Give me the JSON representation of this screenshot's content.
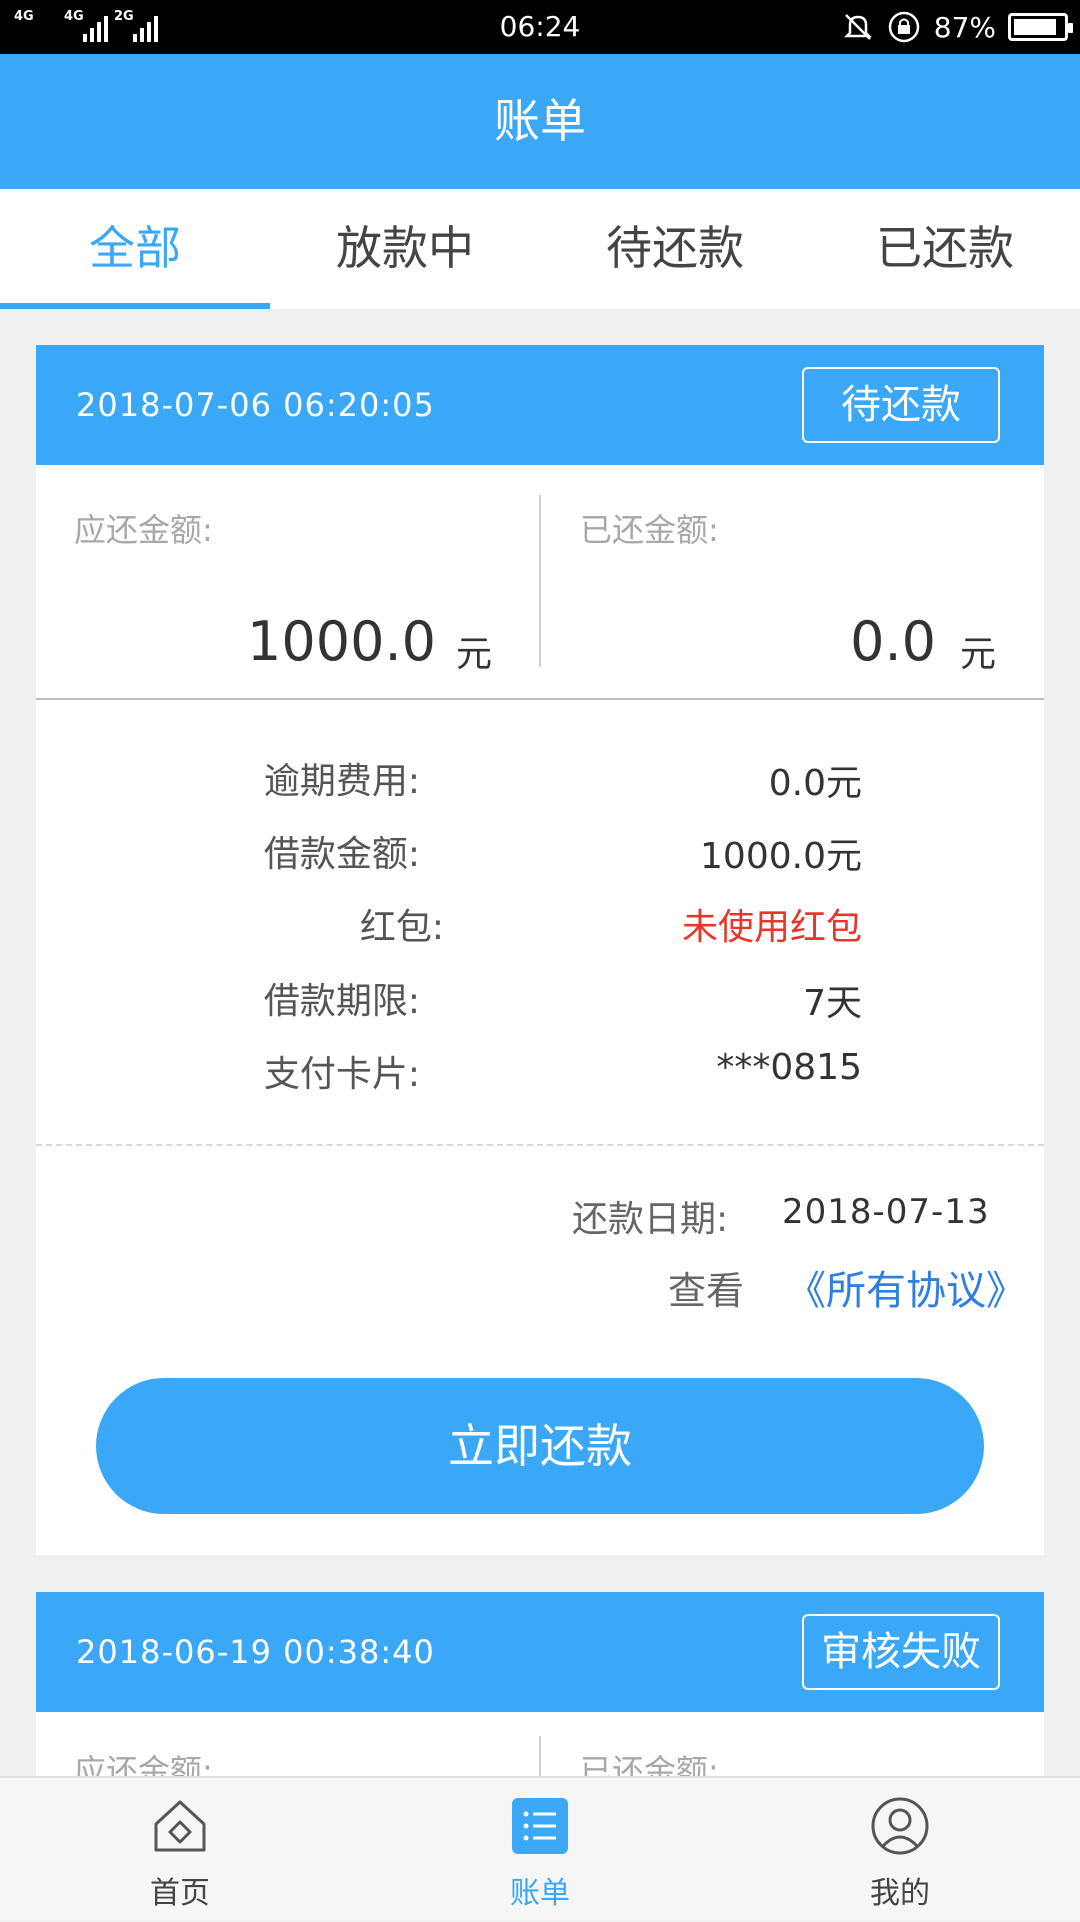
{
  "status_bar": {
    "net1": "4G",
    "net2": "4G",
    "net3": "2G",
    "time": "06:24",
    "battery": "87%",
    "battery_level": 0.87
  },
  "header": {
    "title": "账单"
  },
  "tabs": [
    {
      "label": "全部",
      "active": true
    },
    {
      "label": "放款中",
      "active": false
    },
    {
      "label": "待还款",
      "active": false
    },
    {
      "label": "已还款",
      "active": false
    }
  ],
  "bills": [
    {
      "datetime": "2018-07-06 06:20:05",
      "status": "待还款",
      "due_label": "应还金额:",
      "due_value": "1000.0",
      "due_unit": "元",
      "paid_label": "已还金额:",
      "paid_value": "0.0",
      "paid_unit": "元",
      "details": [
        {
          "label": "逾期费用:",
          "value": "0.0元"
        },
        {
          "label": "借款金额:",
          "value": "1000.0元"
        },
        {
          "label": "红包:",
          "value": "未使用红包"
        },
        {
          "label": "借款期限:",
          "value": "7天"
        },
        {
          "label": "支付卡片:",
          "value": "***0815"
        }
      ],
      "repay_label": "还款日期:",
      "repay_date": "2018-07-13",
      "view_label": "查看",
      "agreement_link": "《所有协议》",
      "pay_button": "立即还款"
    },
    {
      "datetime": "2018-06-19 00:38:40",
      "status": "审核失败",
      "due_label": "应还金额:",
      "paid_label": "已还金额:"
    }
  ],
  "bottom_nav": [
    {
      "label": "首页",
      "icon": "home-icon",
      "active": false
    },
    {
      "label": "账单",
      "icon": "bill-list-icon",
      "active": true
    },
    {
      "label": "我的",
      "icon": "profile-icon",
      "active": false
    }
  ],
  "colors": {
    "primary": "#3aa8f6",
    "link": "#2f7fe0",
    "warning": "#e8352b"
  }
}
